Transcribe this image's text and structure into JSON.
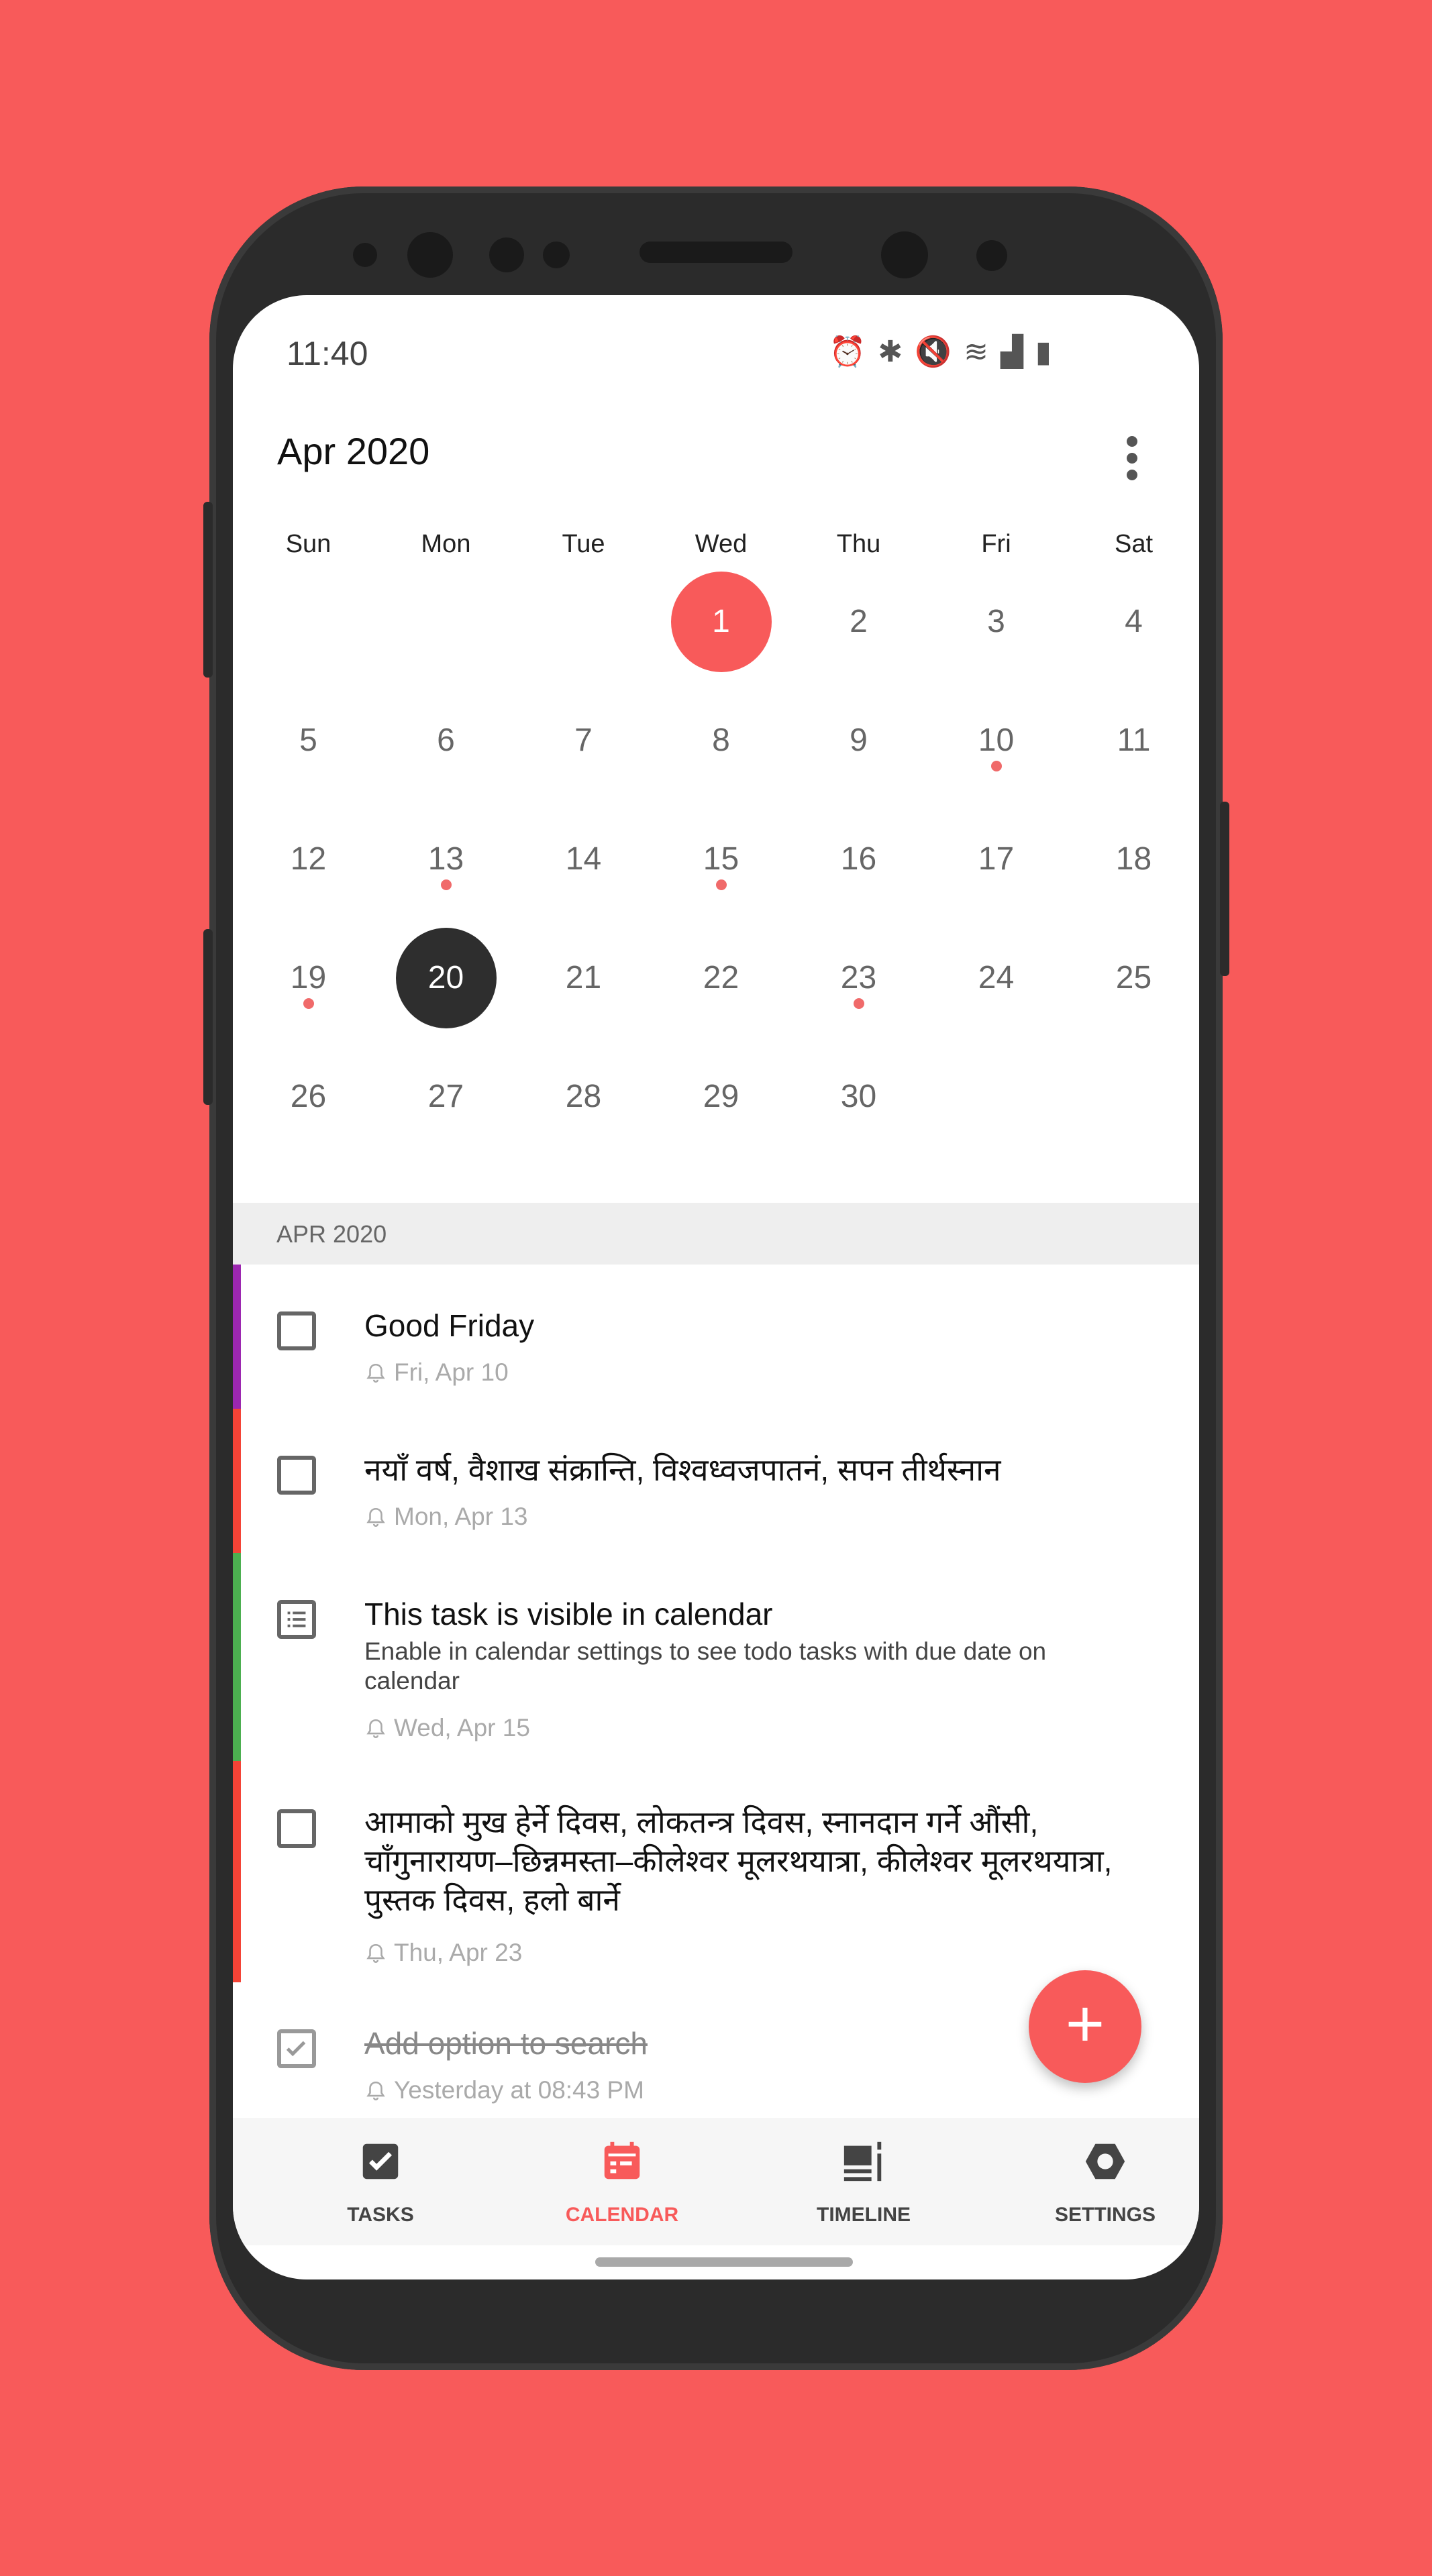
{
  "status_bar": {
    "time": "11:40",
    "icons": [
      "alarm-icon",
      "bluetooth-icon",
      "mute-icon",
      "wifi-icon",
      "signal-icon",
      "battery-icon"
    ]
  },
  "header": {
    "month": "Apr 2020"
  },
  "calendar": {
    "weekdays": [
      "Sun",
      "Mon",
      "Tue",
      "Wed",
      "Thu",
      "Fri",
      "Sat"
    ],
    "days": [
      "1",
      "2",
      "3",
      "4",
      "5",
      "6",
      "7",
      "8",
      "9",
      "10",
      "11",
      "12",
      "13",
      "14",
      "15",
      "16",
      "17",
      "18",
      "19",
      "20",
      "21",
      "22",
      "23",
      "24",
      "25",
      "26",
      "27",
      "28",
      "29",
      "30"
    ],
    "first_weekday_index": 3,
    "highlighted_today": "1",
    "selected_day": "20",
    "days_with_events": [
      "10",
      "13",
      "15",
      "19",
      "23"
    ]
  },
  "section": {
    "label": "APR 2020"
  },
  "tasks": [
    {
      "title": "Good Friday",
      "date": "Fri, Apr 10",
      "color": "#9C27B0",
      "type": "checkbox"
    },
    {
      "title": "नयाँ वर्ष, वैशाख संक्रान्ति, विश्वध्वजपातनं, सपन तीर्थस्नान",
      "date": "Mon, Apr 13",
      "color": "#F44336",
      "type": "checkbox"
    },
    {
      "title": "This task is visible in calendar",
      "subtitle": "Enable in calendar settings to see todo tasks with due date on calendar",
      "date": "Wed, Apr 15",
      "color": "#4CAF50",
      "type": "list"
    },
    {
      "title": "आमाको मुख हेर्ने दिवस, लोकतन्त्र दिवस, स्नानदान गर्ने औंसी, चाँगुनारायण–छिन्नमस्ता–कीलेश्वर मूलरथयात्रा, कीलेश्वर मूलरथयात्रा, पुस्तक दिवस, हलो बार्ने",
      "date": "Thu, Apr 23",
      "color": "#F44336",
      "type": "checkbox"
    },
    {
      "title": "Add option to search",
      "date": "Yesterday at 08:43 PM",
      "color": "",
      "type": "checked"
    }
  ],
  "fab": {
    "label": "+"
  },
  "nav": {
    "tasks": "TASKS",
    "calendar": "CALENDAR",
    "timeline": "TIMELINE",
    "settings": "SETTINGS",
    "active": "calendar"
  },
  "colors": {
    "accent": "#F85A5A",
    "dark": "#2E2E2E"
  }
}
